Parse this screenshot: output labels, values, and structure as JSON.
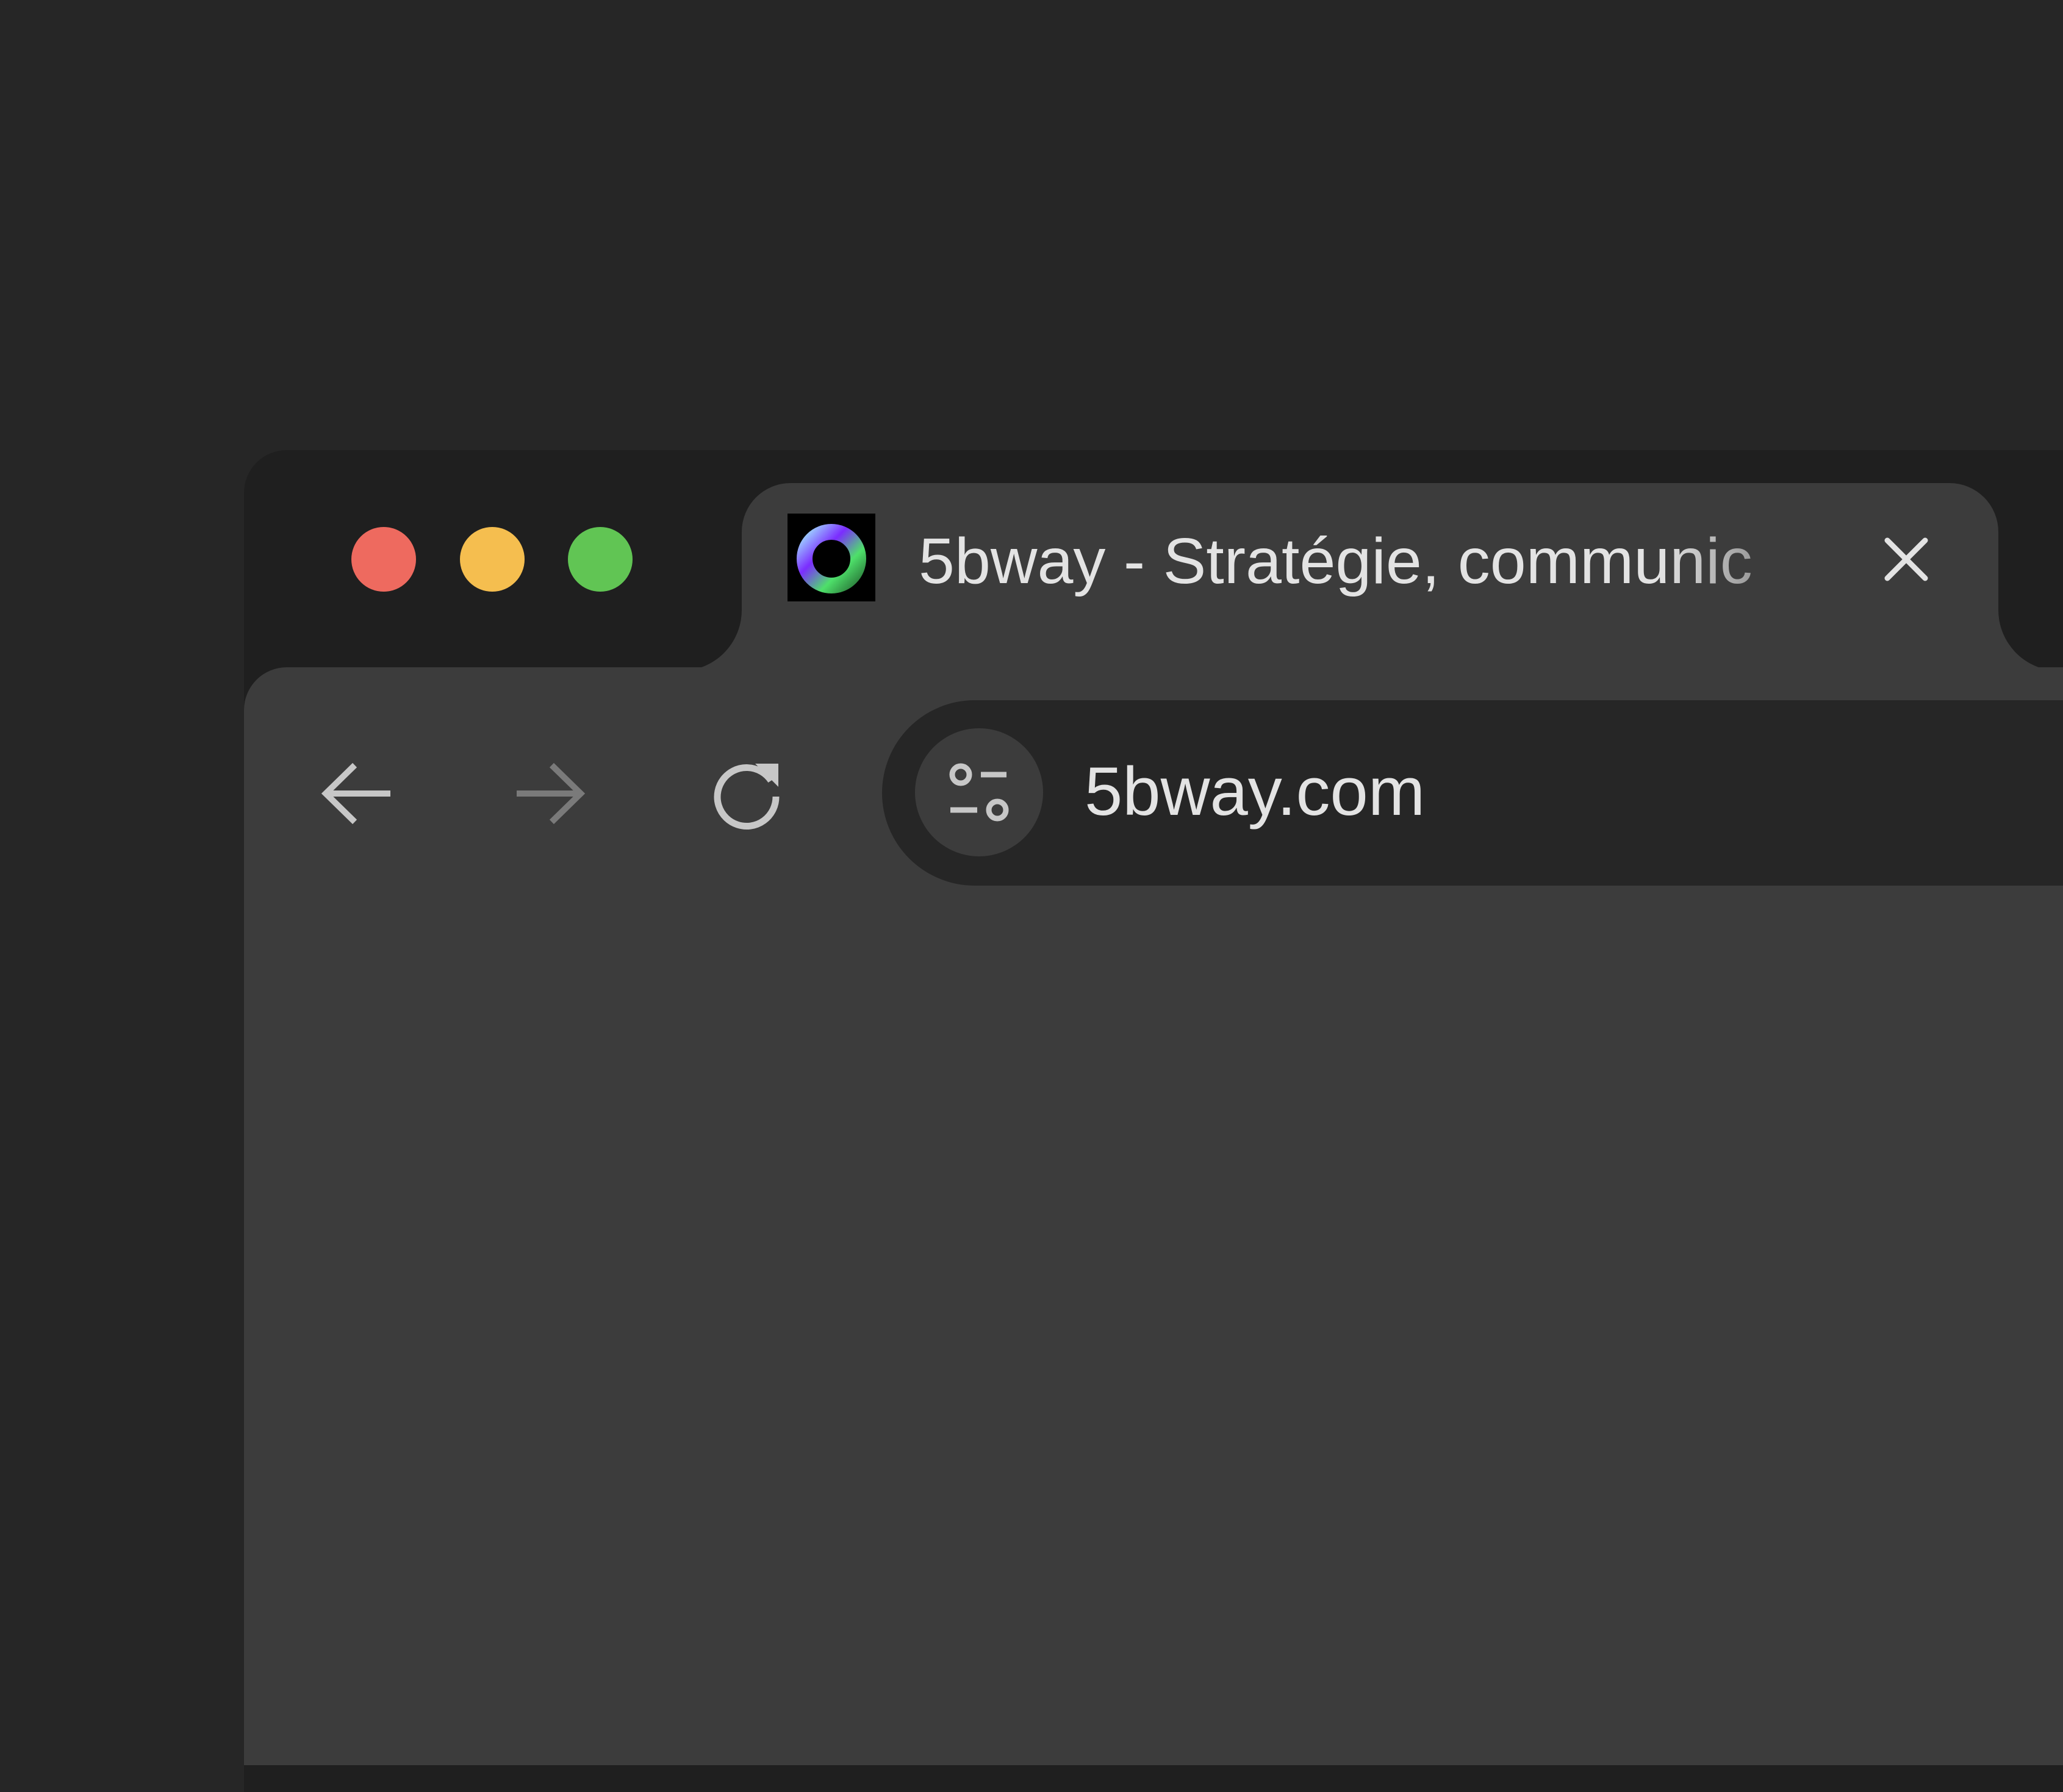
{
  "window": {
    "controls": [
      {
        "name": "close",
        "color": "#ee6a5f"
      },
      {
        "name": "minimize",
        "color": "#f5be4f"
      },
      {
        "name": "maximize",
        "color": "#61c554"
      }
    ]
  },
  "tab": {
    "title": "5bway - Stratégie, communic",
    "favicon": "5bway-ring-logo",
    "close_icon": "close-icon"
  },
  "toolbar": {
    "back_icon": "arrow-left-icon",
    "forward_icon": "arrow-right-icon",
    "reload_icon": "reload-icon",
    "site_info_icon": "tune-icon"
  },
  "omnibox": {
    "url": "5bway.com"
  },
  "colors": {
    "background": "#262626",
    "tabstrip": "#1f1f1f",
    "surface": "#3c3c3c",
    "omnibox": "#262626",
    "text": "#e3e3e3",
    "icon": "#c7c7c7",
    "icon_disabled": "#7a7a7a"
  }
}
